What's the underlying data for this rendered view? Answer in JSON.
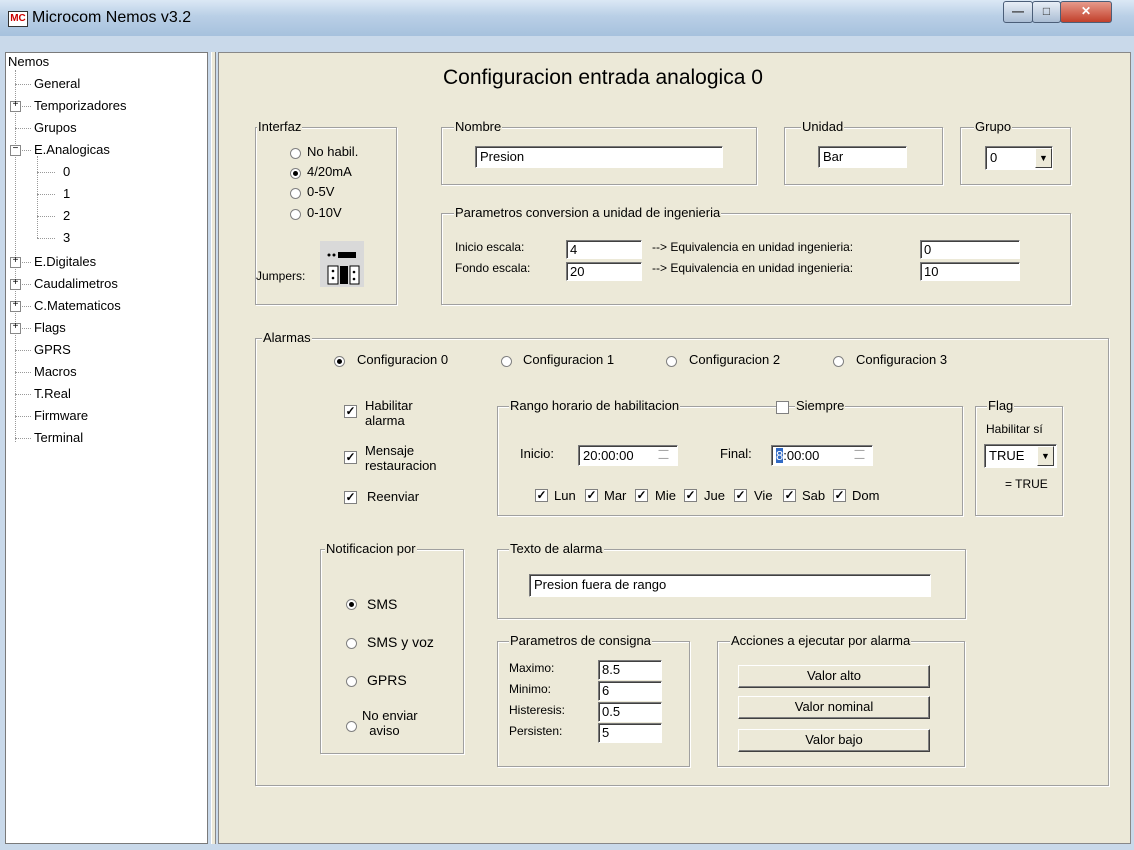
{
  "window": {
    "title": "Microcom Nemos v3.2",
    "icon_text": "MC"
  },
  "tree": {
    "root": "Nemos",
    "items": [
      "General",
      "Temporizadores",
      "Grupos",
      "E.Analogicas",
      "0",
      "1",
      "2",
      "3",
      "E.Digitales",
      "Caudalimetros",
      "C.Matematicos",
      "Flags",
      "GPRS",
      "Macros",
      "T.Real",
      "Firmware",
      "Terminal"
    ]
  },
  "page": {
    "title": "Configuracion entrada analogica  0"
  },
  "interfaz": {
    "legend": "Interfaz",
    "options": [
      "No habil.",
      "4/20mA",
      "0-5V",
      "0-10V"
    ],
    "selected": "4/20mA",
    "jumpers_label": "Jumpers:"
  },
  "nombre": {
    "legend": "Nombre",
    "value": "Presion"
  },
  "unidad": {
    "legend": "Unidad",
    "value": "Bar"
  },
  "grupo": {
    "legend": "Grupo",
    "value": "0"
  },
  "conversion": {
    "legend": "Parametros conversion a unidad de ingenieria",
    "inicio_label": "Inicio escala:",
    "inicio_value": "4",
    "fondo_label": "Fondo escala:",
    "fondo_value": "20",
    "equiv_label": "--> Equivalencia en unidad ingenieria:",
    "equiv1_value": "0",
    "equiv2_value": "10"
  },
  "alarmas": {
    "legend": "Alarmas",
    "configs": [
      "Configuracion 0",
      "Configuracion 1",
      "Configuracion 2",
      "Configuracion 3"
    ],
    "selected_config": "Configuracion 0",
    "habilitar": {
      "label_line1": "Habilitar",
      "label_line2": "alarma",
      "checked": true
    },
    "mensaje": {
      "label_line1": "Mensaje",
      "label_line2": "restauracion",
      "checked": true
    },
    "reenviar": {
      "label": "Reenviar",
      "checked": true
    },
    "rango": {
      "legend": "Rango horario de habilitacion",
      "siempre_label": "Siempre",
      "siempre_checked": false,
      "inicio_label": "Inicio:",
      "inicio_value": "20:00:00",
      "final_label": "Final:",
      "final_hour": "8",
      "final_rest": ":00:00",
      "days": [
        "Lun",
        "Mar",
        "Mie",
        "Jue",
        "Vie",
        "Sab",
        "Dom"
      ]
    },
    "flag": {
      "legend": "Flag",
      "habilitar_label": "Habilitar sí",
      "value": "TRUE",
      "result": "= TRUE"
    },
    "notificacion": {
      "legend": "Notificacion por",
      "options": [
        "SMS",
        "SMS y voz",
        "GPRS"
      ],
      "no_enviar_line1": "No enviar",
      "no_enviar_line2": "aviso",
      "selected": "SMS"
    },
    "texto": {
      "legend": "Texto de alarma",
      "value": "Presion fuera de rango"
    },
    "consigna": {
      "legend": "Parametros de consigna",
      "rows": [
        {
          "label": "Maximo:",
          "value": "8.5"
        },
        {
          "label": "Minimo:",
          "value": "6"
        },
        {
          "label": "Histeresis:",
          "value": "0.5"
        },
        {
          "label": "Persisten:",
          "value": "5"
        }
      ]
    },
    "acciones": {
      "legend": "Acciones a ejecutar por alarma",
      "buttons": [
        "Valor alto",
        "Valor nominal",
        "Valor bajo"
      ]
    }
  }
}
